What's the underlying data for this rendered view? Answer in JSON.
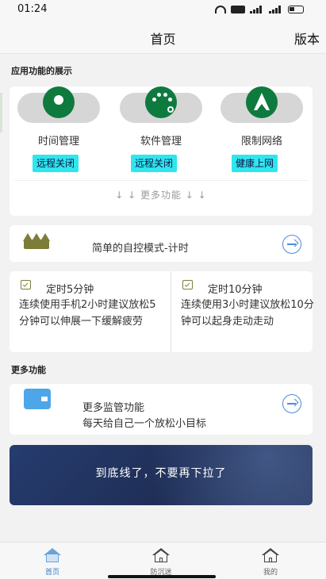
{
  "status_bar": {
    "time": "01:24"
  },
  "nav": {
    "title": "首页",
    "right_label": "版本"
  },
  "sections": {
    "app_features_title": "应用功能的展示",
    "more_features_title": "更多功能"
  },
  "features": [
    {
      "label": "时间管理",
      "tag": "远程关闭",
      "icon": "location-pin-icon"
    },
    {
      "label": "软件管理",
      "tag": "远程关闭",
      "icon": "palette-icon"
    },
    {
      "label": "限制网络",
      "tag": "健康上网",
      "icon": "navigation-arrow-icon"
    }
  ],
  "features_more": "↓ ↓ 更多功能 ↓ ↓",
  "mode_card": {
    "label": "简单的自控模式-计时",
    "icon": "crown-icon"
  },
  "timers": [
    {
      "title": "定时5分钟",
      "desc": "连续使用手机2小时建议放松5分钟可以伸展一下缓解疲劳"
    },
    {
      "title": "定时10分钟",
      "desc": "连续使用3小时建议放松10分钟可以起身走动走动"
    }
  ],
  "more_card": {
    "title": "更多监管功能",
    "subtitle": "每天给自己一个放松小目标",
    "icon": "wallet-icon"
  },
  "banner": {
    "text": "到底线了，不要再下拉了"
  },
  "tabbar": {
    "items": [
      {
        "label": "首页",
        "active": true
      },
      {
        "label": "防沉迷",
        "active": false
      },
      {
        "label": "我的",
        "active": false
      }
    ]
  },
  "colors": {
    "accent_green": "#0f7a3e",
    "tag_cyan": "#2ee6ee",
    "link_blue": "#4d8ad6",
    "banner_navy": "#1f2f57"
  }
}
